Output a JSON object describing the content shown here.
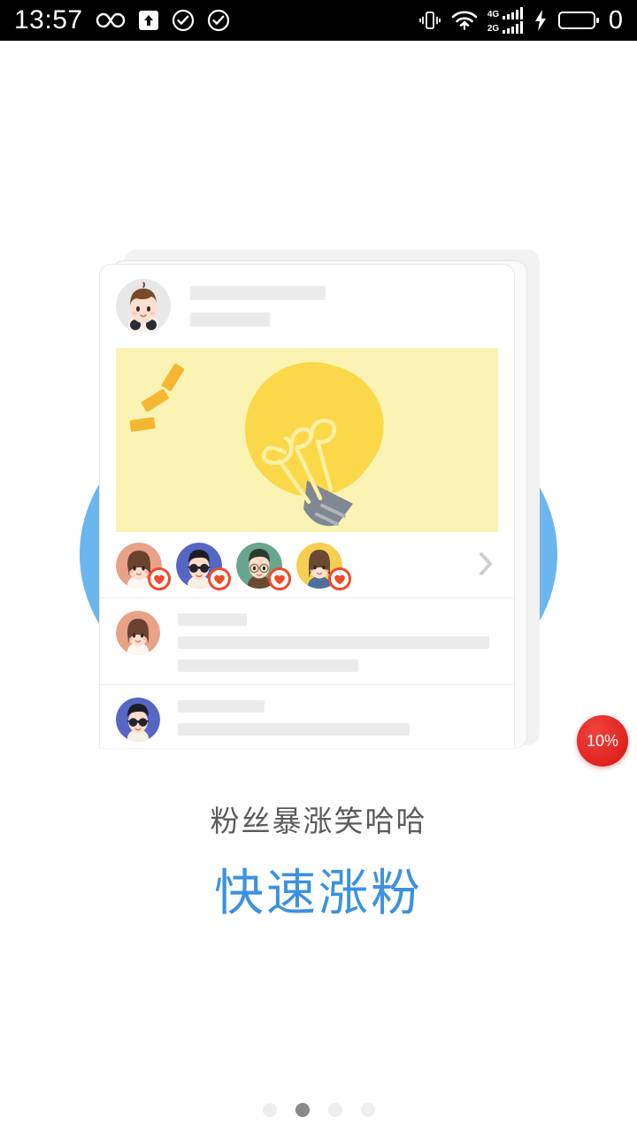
{
  "statusbar": {
    "clock": "13:57",
    "battery_percent": "0",
    "left_icons": [
      {
        "name": "infinity-icon",
        "glyph": "∞"
      },
      {
        "name": "upload-icon",
        "glyph": "↑"
      },
      {
        "name": "check-circle-icon-1",
        "glyph": "✓"
      },
      {
        "name": "check-circle-icon-2",
        "glyph": "✓"
      }
    ],
    "right_icons": [
      {
        "name": "vibrate-icon"
      },
      {
        "name": "wifi-icon"
      },
      {
        "name": "signal-4g-icon",
        "label": "4G"
      },
      {
        "name": "signal-2g-icon",
        "label": "2G"
      },
      {
        "name": "charging-bolt-icon",
        "glyph": "⚡"
      },
      {
        "name": "battery-icon"
      }
    ]
  },
  "badge": {
    "label": "10%"
  },
  "captions": {
    "subtitle": "粉丝暴涨笑哈哈",
    "title": "快速涨粉",
    "subtitle_color": "#5b5b5b",
    "title_color": "#3c92df"
  },
  "card": {
    "post_author_avatar": "avatar-boy-brown-hair",
    "post_image": "lightbulb-illustration",
    "likes": [
      {
        "avatar": "avatar-girl-long-brown-hair",
        "bg": "#e8a288",
        "reaction": "heart-icon"
      },
      {
        "avatar": "avatar-man-sunglasses",
        "bg": "#5566c4",
        "reaction": "heart-icon"
      },
      {
        "avatar": "avatar-man-glasses",
        "bg": "#6aa58f",
        "reaction": "heart-icon"
      },
      {
        "avatar": "avatar-girl-yellow-bg",
        "bg": "#f5cf52",
        "reaction": "heart-icon"
      }
    ],
    "likes_more_icon": "chevron-right-icon",
    "comments": [
      {
        "avatar": "avatar-girl-bob-hair",
        "lines": 3
      },
      {
        "avatar": "avatar-man-sunglasses",
        "lines": 2
      }
    ]
  },
  "pager": {
    "count": 4,
    "active_index": 1
  },
  "colors": {
    "page_background": "#ffffff",
    "accent_blue": "#6cb6f0",
    "image_yellow": "#faf3b4",
    "bulb_yellow": "#fbd84a",
    "badge_red": "#e0231f",
    "placeholder_gray": "#ebebeb"
  }
}
